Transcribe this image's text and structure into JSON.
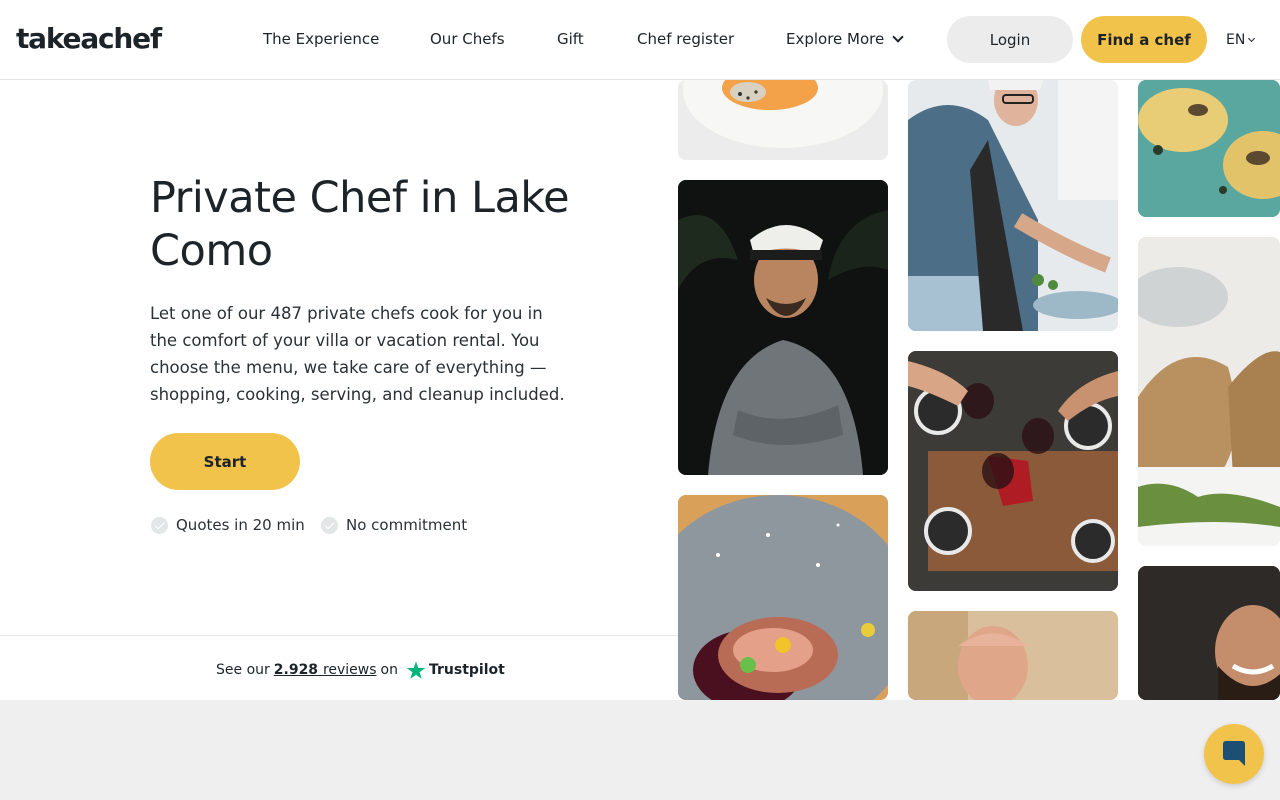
{
  "header": {
    "logo": "takeachef",
    "nav": {
      "experience": "The Experience",
      "chefs": "Our Chefs",
      "gift": "Gift",
      "register": "Chef register",
      "explore": "Explore More"
    },
    "login": "Login",
    "find_chef": "Find a chef",
    "lang": "EN"
  },
  "hero": {
    "title": "Private Chef in Lake Como",
    "description": "Let one of our 487 private chefs cook for you in the comfort of your villa or vacation rental. You choose the menu, we take care of everything — shopping, cooking, serving, and cleanup included.",
    "start": "Start",
    "features": [
      "Quotes in 20 min",
      "No commitment"
    ]
  },
  "trustpilot": {
    "prefix": "See our",
    "count": "2.928",
    "reviews_word": "reviews",
    "on": "on",
    "brand": "Trustpilot"
  },
  "colors": {
    "accent": "#f2c34b",
    "text": "#1c2329",
    "trustpilot_green": "#00b67a"
  }
}
